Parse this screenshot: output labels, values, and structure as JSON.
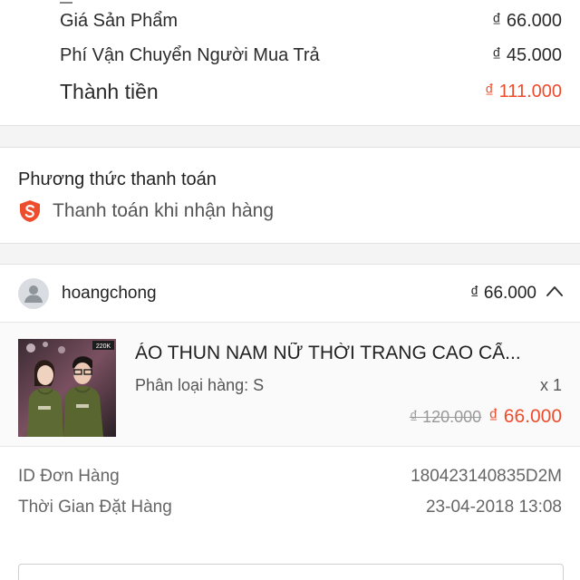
{
  "summary": {
    "product_price_label": "Giá Sản Phẩm",
    "product_price_value": "₫ 66.000",
    "shipping_label": "Phí Vận Chuyển Người Mua Trả",
    "shipping_value": "₫ 45.000",
    "total_label": "Thành tiền",
    "total_value": "₫ 111.000"
  },
  "payment": {
    "title": "Phương thức thanh toán",
    "method": "Thanh toán khi nhận hàng",
    "icon": "shopee-shield-icon"
  },
  "shop": {
    "name": "hoangchong",
    "total": "₫ 66.000",
    "toggle_icon": "chevron-up-icon"
  },
  "product": {
    "name": "ÁO THUN NAM NỮ THỜI TRANG CAO CẤ...",
    "variant": "Phân loại hàng: S",
    "quantity": "x 1",
    "original_price": "₫ 120.000",
    "price": "₫ 66.000",
    "thumb_badge": "220K"
  },
  "order_info": {
    "id_label": "ID Đơn Hàng",
    "id_value": "180423140835D2M",
    "time_label": "Thời Gian Đặt Hàng",
    "time_value": "23-04-2018 13:08"
  },
  "colors": {
    "accent": "#ee4d2d",
    "background": "#f4f4f4"
  }
}
